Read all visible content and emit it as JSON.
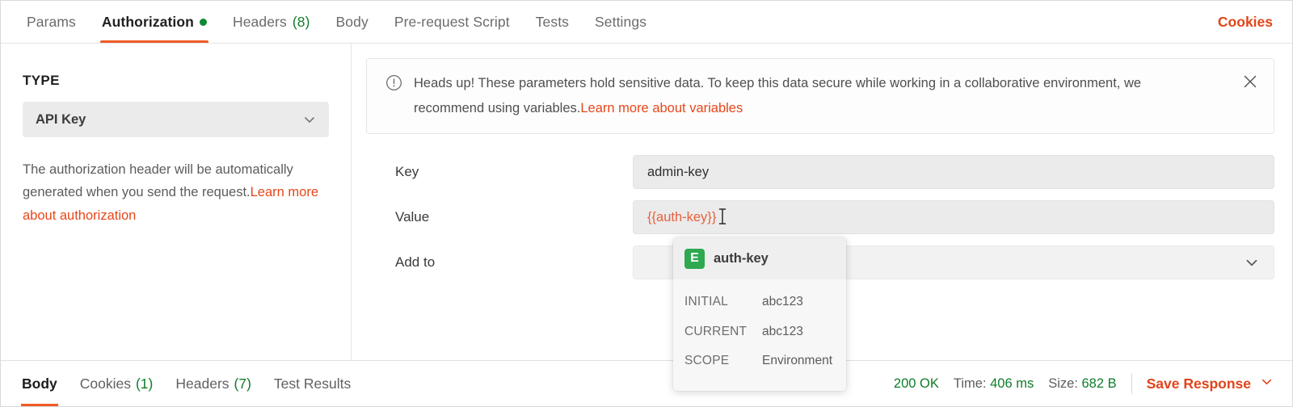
{
  "tabs": [
    {
      "label": "Params",
      "count": "",
      "active": false,
      "dot": false
    },
    {
      "label": "Authorization",
      "count": "",
      "active": true,
      "dot": true
    },
    {
      "label": "Headers",
      "count": "(8)",
      "active": false,
      "dot": false
    },
    {
      "label": "Body",
      "count": "",
      "active": false,
      "dot": false
    },
    {
      "label": "Pre-request Script",
      "count": "",
      "active": false,
      "dot": false
    },
    {
      "label": "Tests",
      "count": "",
      "active": false,
      "dot": false
    },
    {
      "label": "Settings",
      "count": "",
      "active": false,
      "dot": false
    }
  ],
  "cookies_link": "Cookies",
  "left": {
    "type_label": "TYPE",
    "type_value": "API Key",
    "help_text": "The authorization header will be automatically generated when you send the request.",
    "help_link": "Learn more about authorization"
  },
  "banner": {
    "icon": "alert-circle-icon",
    "text": "Heads up! These parameters hold sensitive data. To keep this data secure while working in a collaborative environment, we recommend using variables.",
    "link": "Learn more about variables",
    "close_icon": "close-icon"
  },
  "form": {
    "key_label": "Key",
    "key_value": "admin-key",
    "value_label": "Value",
    "value_value": "{{auth-key}}",
    "addto_label": "Add to",
    "addto_value": ""
  },
  "popover": {
    "badge": "E",
    "name": "auth-key",
    "rows": [
      {
        "key": "INITIAL",
        "value": "abc123"
      },
      {
        "key": "CURRENT",
        "value": "abc123"
      },
      {
        "key": "SCOPE",
        "value": "Environment"
      }
    ]
  },
  "status": {
    "tabs": [
      {
        "label": "Body",
        "count": "",
        "active": true
      },
      {
        "label": "Cookies",
        "count": "(1)",
        "active": false
      },
      {
        "label": "Headers",
        "count": "(7)",
        "active": false
      },
      {
        "label": "Test Results",
        "count": "",
        "active": false
      }
    ],
    "status_code": "200 OK",
    "time_label": "Time:",
    "time_value": "406 ms",
    "size_label": "Size:",
    "size_value": "682 B",
    "save_response": "Save Response"
  },
  "colors": {
    "accent_orange": "#ef5b25",
    "link_orange": "#e8461a",
    "success_green": "#0f7d29",
    "env_green": "#2fa84f",
    "variable_orange": "#e8603a"
  }
}
